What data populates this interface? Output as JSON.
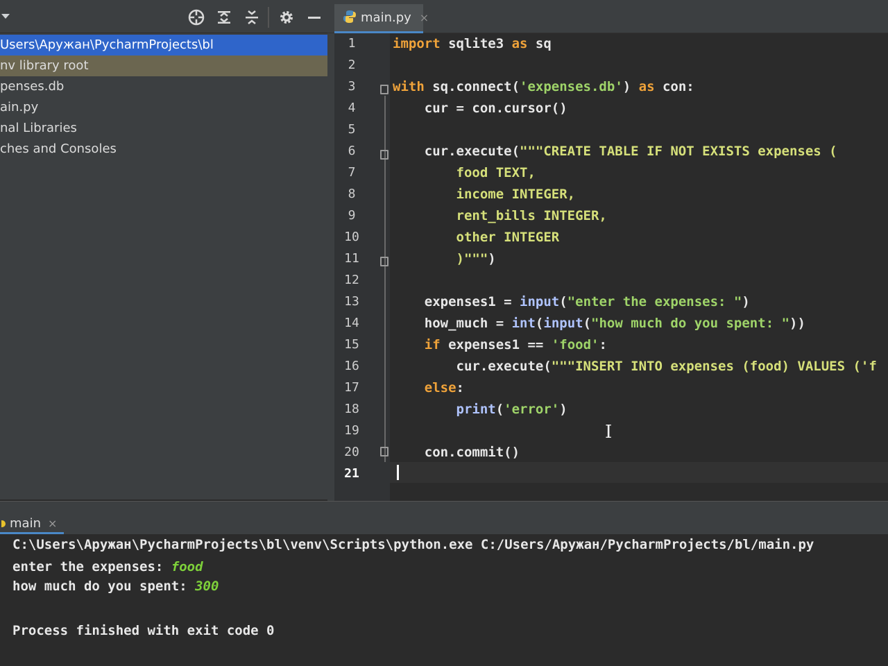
{
  "editor_tab": {
    "label": "main.py",
    "close": "×"
  },
  "toolbar": {
    "icons": [
      "locate-icon",
      "expand-all-icon",
      "collapse-all-icon",
      "gear-icon",
      "hide-icon"
    ]
  },
  "project_tree": [
    "Users\\Аружан\\PycharmProjects\\bl",
    "nv  library root",
    "penses.db",
    "ain.py",
    "nal Libraries",
    "ches and Consoles"
  ],
  "line_numbers": [
    "1",
    "2",
    "3",
    "4",
    "5",
    "6",
    "7",
    "8",
    "9",
    "10",
    "11",
    "12",
    "13",
    "14",
    "15",
    "16",
    "17",
    "18",
    "19",
    "20",
    "21"
  ],
  "code": {
    "l1": {
      "a": "import",
      "b": " sqlite3 ",
      "c": "as",
      "d": " sq"
    },
    "l3": {
      "a": "with",
      "b": " sq.connect(",
      "c": "'expenses.db'",
      "d": ") ",
      "e": "as",
      "f": " con:"
    },
    "l4": {
      "a": "    cur = con.cursor()"
    },
    "l6": {
      "a": "    cur.execute(",
      "b": "\"\"\"CREATE TABLE IF NOT EXISTS expenses ("
    },
    "l7": {
      "a": "        food TEXT,"
    },
    "l8": {
      "a": "        income INTEGER,"
    },
    "l9": {
      "a": "        rent_bills INTEGER,"
    },
    "l10": {
      "a": "        other INTEGER"
    },
    "l11": {
      "a": "        )\"\"\"",
      "b": ")"
    },
    "l13": {
      "a": "    expenses1 = ",
      "b": "input",
      "c": "(",
      "d": "\"enter the expenses: \"",
      "e": ")"
    },
    "l14": {
      "a": "    how_much = ",
      "b": "int",
      "c": "(",
      "d": "input",
      "e": "(",
      "f": "\"how much do you spent: \"",
      "g": "))"
    },
    "l15": {
      "a": "    ",
      "b": "if",
      "c": " expenses1 == ",
      "d": "'food'",
      "e": ":"
    },
    "l16": {
      "a": "        cur.execute(",
      "b": "\"\"\"INSERT INTO expenses (food) VALUES ('f"
    },
    "l17": {
      "a": "    ",
      "b": "else",
      "c": ":"
    },
    "l18": {
      "a": "        ",
      "b": "print",
      "c": "(",
      "d": "'error'",
      "e": ")"
    },
    "l20": {
      "a": "    con.commit()"
    }
  },
  "run": {
    "tab_label": "main",
    "tab_close": "×",
    "command": "C:\\Users\\Аружан\\PycharmProjects\\bl\\venv\\Scripts\\python.exe C:/Users/Аружан/PycharmProjects/bl/main.py",
    "prompt1": "enter the expenses: ",
    "input1": "food",
    "prompt2": "how much do you spent: ",
    "input2": "300",
    "finished": "Process finished with exit code 0"
  }
}
